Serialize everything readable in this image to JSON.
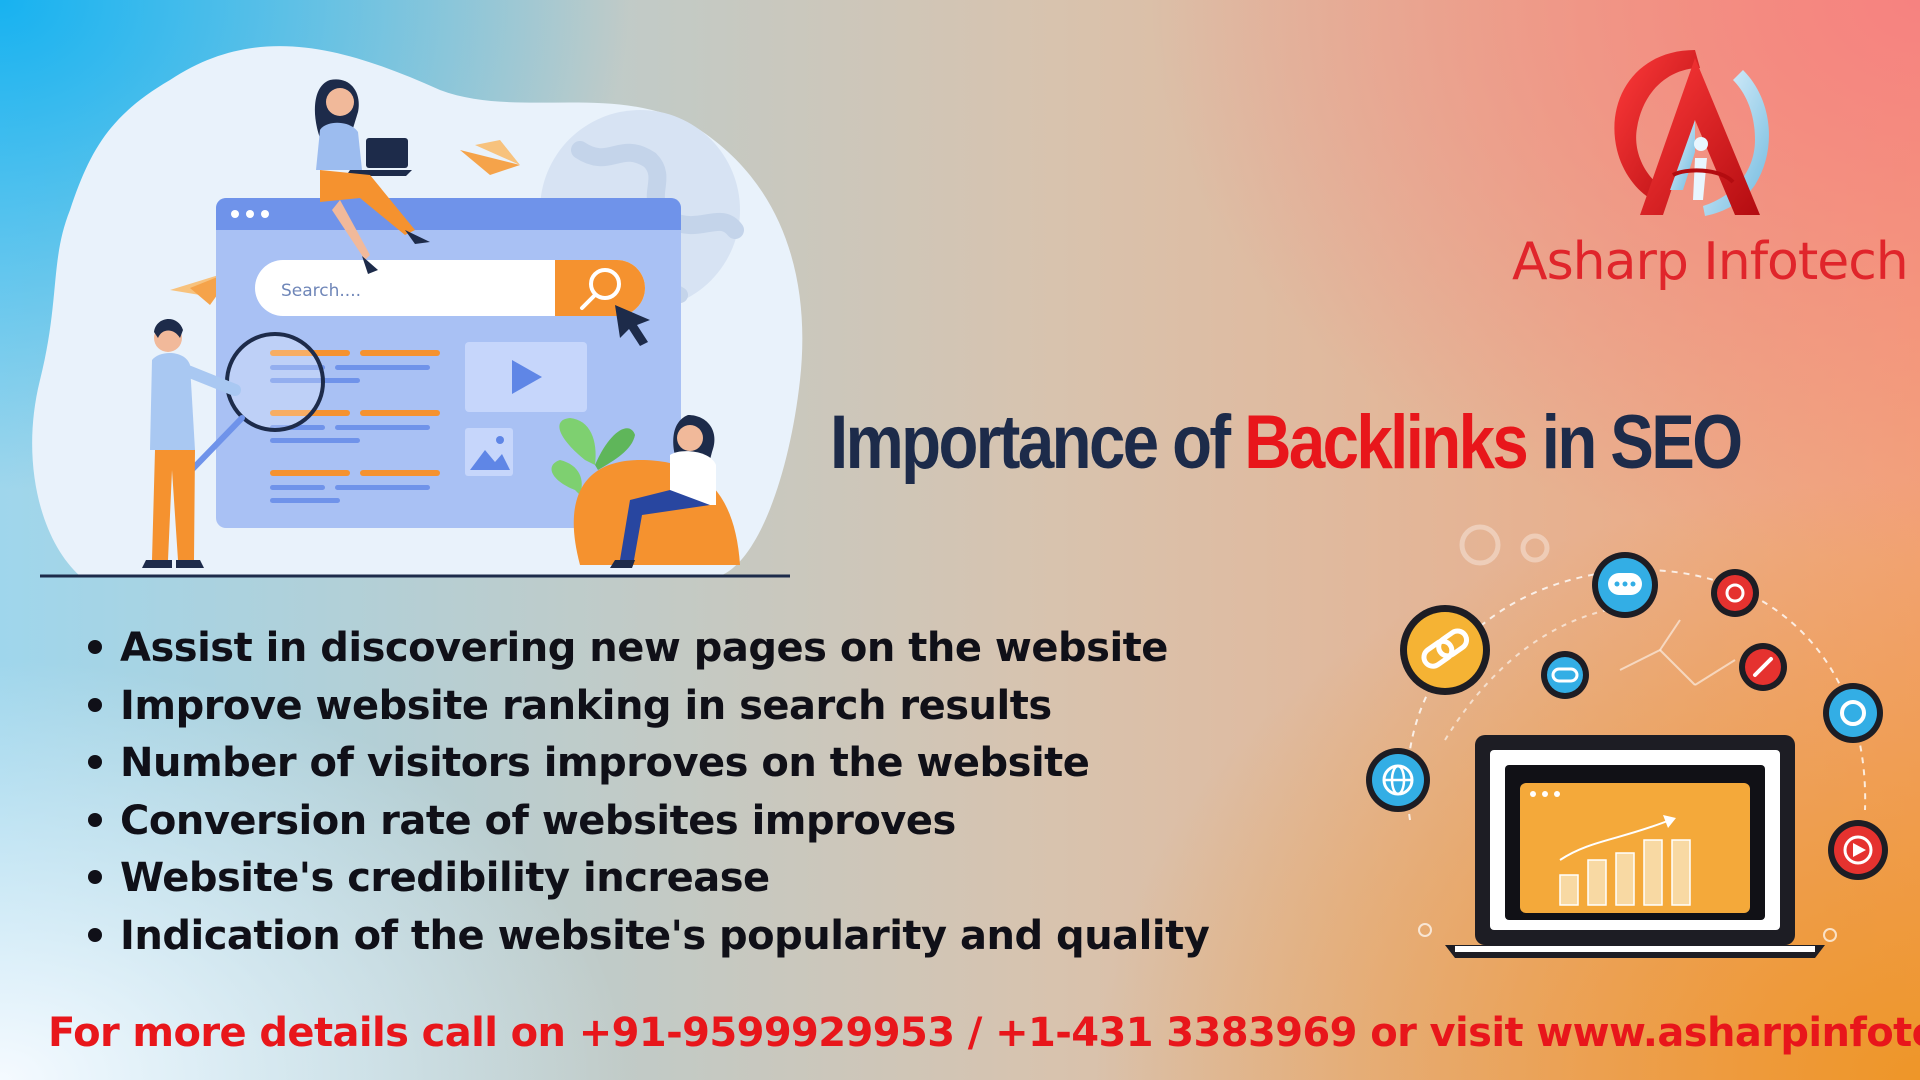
{
  "brand": {
    "name": "Asharp Infotech",
    "logo_letter": "A",
    "color": "#e0252b"
  },
  "illustration": {
    "search_placeholder": "Search....",
    "search_icon": "magnifier-icon",
    "cursor_icon": "cursor-arrow-icon"
  },
  "headline": {
    "part1": "Importance of ",
    "highlight": "Backlinks",
    "part2": " in SEO",
    "dark_color": "#1d2b4a",
    "highlight_color": "#e8161b"
  },
  "bullets": [
    "Assist in discovering new pages on the website",
    "Improve website ranking in search results",
    "Number of visitors improves on the website",
    "Conversion rate of websites improves",
    "Website's credibility increase",
    "Indication of the website's popularity and quality"
  ],
  "footer": {
    "text": "For more details call on +91-9599929953 / +1-431 3383969 or visit www.asharpinfotech.com"
  },
  "network_icons": [
    "link-icon",
    "chat-icon",
    "gear-icon",
    "globe-icon",
    "play-icon",
    "settings-icon",
    "link-small-icon"
  ]
}
